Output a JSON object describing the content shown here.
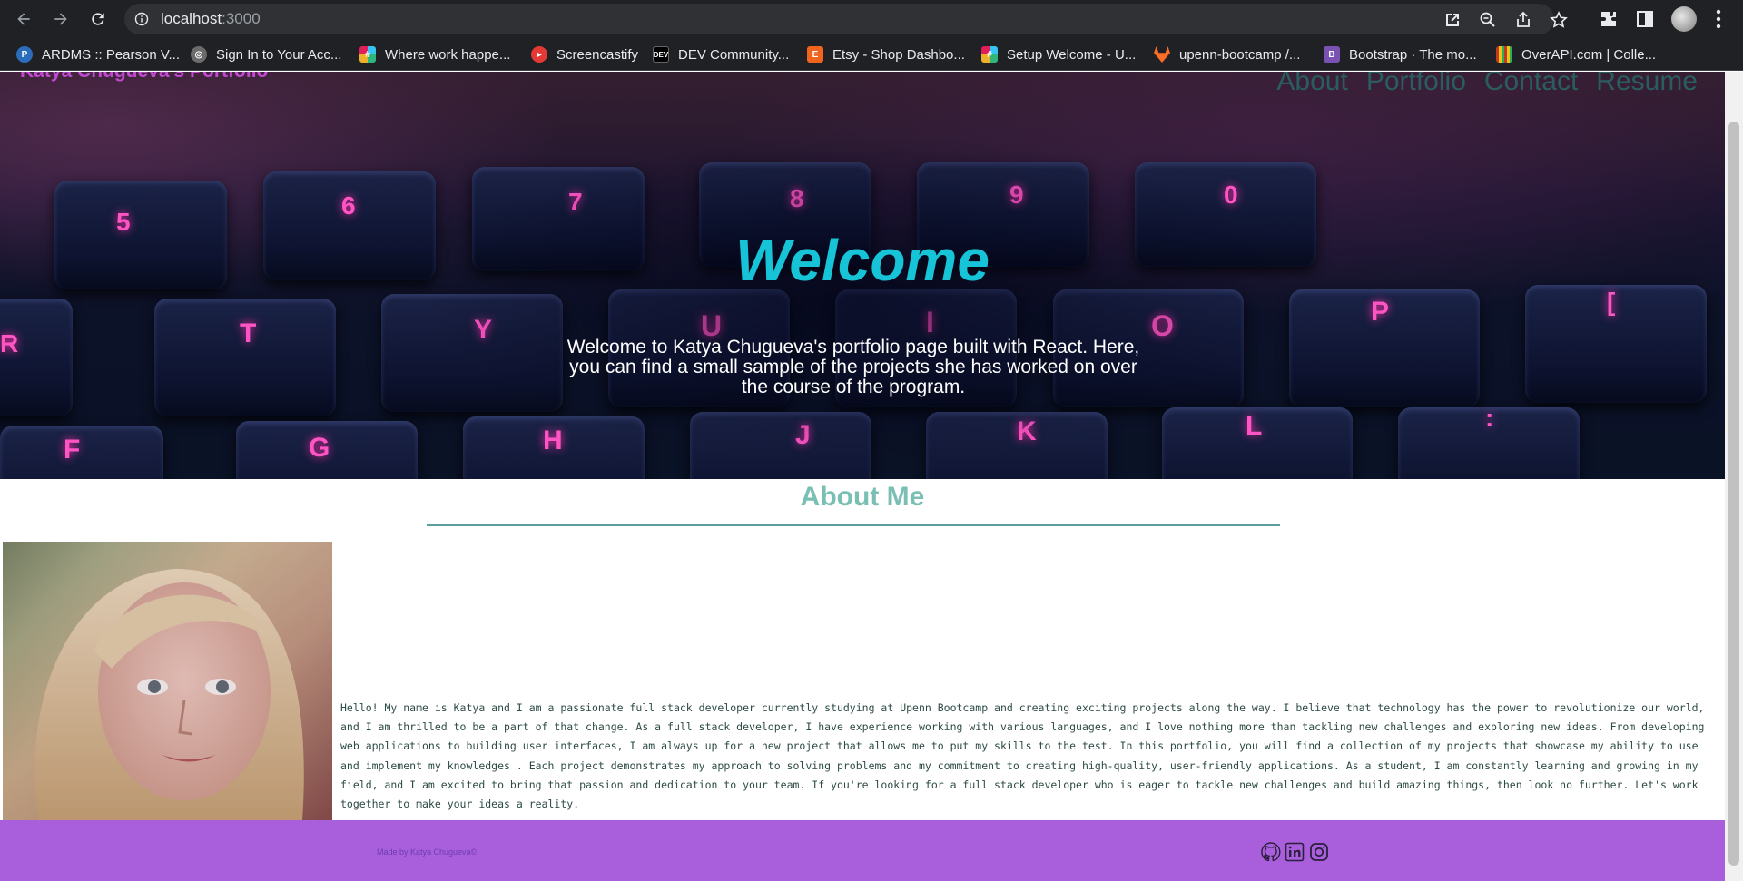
{
  "browser": {
    "url_host": "localhost",
    "url_port": ":3000",
    "bookmarks": [
      {
        "label": "ARDMS :: Pearson V...",
        "icon": "pearson-icon",
        "color": "#2a6ebb"
      },
      {
        "label": "Sign In to Your Acc...",
        "icon": "globe-icon",
        "color": "#8a8a8a"
      },
      {
        "label": "Where work happe...",
        "icon": "slack-icon",
        "color": "#e01e5a"
      },
      {
        "label": "Screencastify",
        "icon": "screencastify-icon",
        "color": "#e53935"
      },
      {
        "label": "DEV Community...",
        "icon": "dev-icon",
        "color": "#000000"
      },
      {
        "label": "Etsy - Shop Dashbo...",
        "icon": "etsy-icon",
        "color": "#f1641e"
      },
      {
        "label": "Setup Welcome - U...",
        "icon": "slack-icon",
        "color": "#36c5f0"
      },
      {
        "label": "upenn-bootcamp /...",
        "icon": "gitlab-icon",
        "color": "#fc6d26"
      },
      {
        "label": "Bootstrap · The mo...",
        "icon": "bootstrap-icon",
        "color": "#7952b3"
      },
      {
        "label": "OverAPI.com | Colle...",
        "icon": "overapi-icon",
        "color": "#c0392b"
      }
    ]
  },
  "site": {
    "title": "Katya Chugueva's Portfolio",
    "nav": [
      "About",
      "Portfolio",
      "Contact",
      "Resume"
    ],
    "hero": {
      "title": "Welcome",
      "text": "Welcome to Katya Chugueva's portfolio page built with React. Here, you can find a small sample of the projects she has worked on over the course of the program."
    },
    "about": {
      "title": "About Me",
      "text": "Hello! My name is Katya and I am a passionate full stack developer currently studying at Upenn Bootcamp and creating exciting projects along the way. I believe that technology has the power to revolutionize our world, and I am thrilled to be a part of that change. As a full stack developer, I have experience working with various languages, and I love nothing more than tackling new challenges and exploring new ideas. From developing web applications to building user interfaces, I am always up for a new project that allows me to put my skills to the test. In this portfolio, you will find a collection of my projects that showcase my ability to use and implement my knowledges . Each project demonstrates my approach to solving problems and my commitment to creating high-quality, user-friendly applications. As a student, I am constantly learning and growing in my field, and I am excited to bring that passion and dedication to your team. If you're looking for a full stack developer who is eager to tackle new challenges and build amazing things, then look no further. Let's work together to make your ideas a reality."
    },
    "footer": {
      "credit": "Made by Katya Chugueva©",
      "social": [
        "github-icon",
        "linkedin-icon",
        "instagram-icon"
      ]
    },
    "keyboard_keys": [
      "5",
      "6",
      "7",
      "8",
      "9",
      "0",
      "R",
      "T",
      "Y",
      "U",
      "I",
      "O",
      "P",
      "[",
      "F",
      "G",
      "H",
      "J",
      "K",
      "L",
      ":"
    ]
  }
}
